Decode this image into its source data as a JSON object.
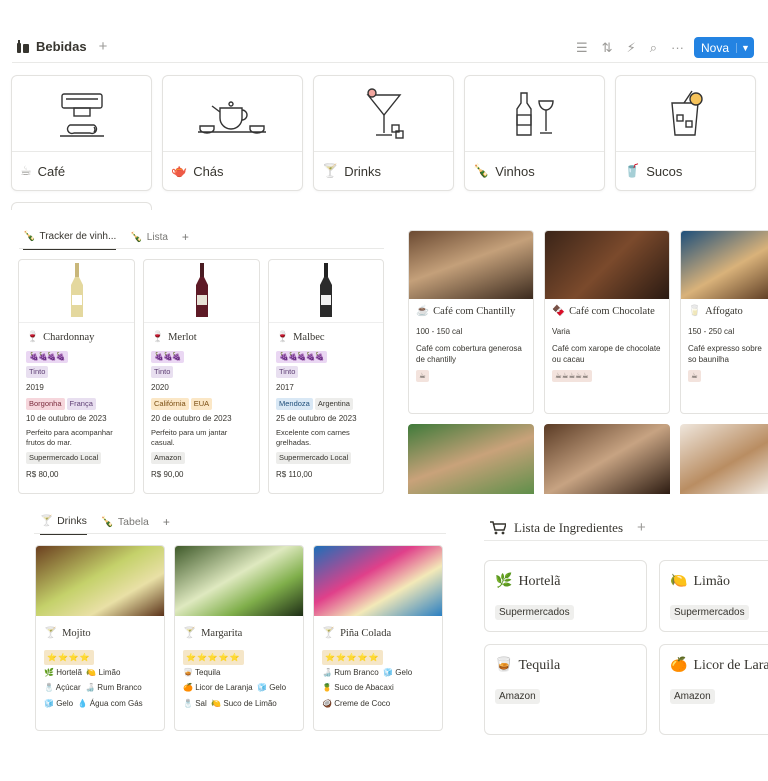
{
  "header": {
    "title": "Bebidas",
    "new_button": "Nova"
  },
  "categories": [
    {
      "label": "Café",
      "icon": "coffee-cup-icon"
    },
    {
      "label": "Chás",
      "icon": "teapot-icon"
    },
    {
      "label": "Drinks",
      "icon": "cocktail-glass-icon"
    },
    {
      "label": "Vinhos",
      "icon": "wine-bottle-icon"
    },
    {
      "label": "Sucos",
      "icon": "juice-cup-icon"
    }
  ],
  "wine_tabs": {
    "tab1": "Tracker de vinh...",
    "tab2": "Lista"
  },
  "wines": [
    {
      "name": "Chardonnay",
      "rating": "🍇🍇🍇🍇",
      "type": "Tinto",
      "year": "2019",
      "tags": [
        "Borgonha",
        "França"
      ],
      "date": "10 de outubro de 2023",
      "note": "Perfeito para acompanhar frutos do mar.",
      "store": "Supermercado Local",
      "price": "R$ 80,00"
    },
    {
      "name": "Merlot",
      "rating": "🍇🍇🍇",
      "type": "Tinto",
      "year": "2020",
      "tags": [
        "Califórnia",
        "EUA"
      ],
      "date": "20 de outubro de 2023",
      "note": "Perfeito para um jantar casual.",
      "store": "Amazon",
      "price": "R$ 90,00"
    },
    {
      "name": "Malbec",
      "rating": "🍇🍇🍇🍇🍇",
      "type": "Tinto",
      "year": "2017",
      "tags": [
        "Mendoza",
        "Argentina"
      ],
      "date": "25 de outubro de 2023",
      "note": "Excelente com carnes grelhadas.",
      "store": "Supermercado Local",
      "price": "R$ 110,00"
    }
  ],
  "coffees": [
    {
      "name": "Café com Chantilly",
      "cal": "100 - 150 cal",
      "desc": "Café com cobertura generosa de chantilly",
      "badge": "☕"
    },
    {
      "name": "Café com Chocolate",
      "cal": "Varia",
      "desc": "Café com xarope de chocolate ou cacau",
      "badge": "☕☕☕☕☕"
    },
    {
      "name": "Affogato",
      "cal": "150 - 250 cal",
      "desc": "Café expresso sobre so baunilha",
      "badge": "☕"
    }
  ],
  "drink_tabs": {
    "tab1": "Drinks",
    "tab2": "Tabela"
  },
  "drinks": [
    {
      "name": "Mojito",
      "stars": "⭐⭐⭐⭐",
      "ing": [
        [
          "Hortelã",
          "Limão"
        ],
        [
          "Açúcar",
          "Rum Branco"
        ],
        [
          "Gelo",
          "Água com Gás"
        ]
      ]
    },
    {
      "name": "Margarita",
      "stars": "⭐⭐⭐⭐⭐",
      "ing": [
        [
          "Tequila"
        ],
        [
          "Licor de Laranja",
          "Gelo"
        ],
        [
          "Sal",
          "Suco de Limão"
        ]
      ]
    },
    {
      "name": "Piña Colada",
      "stars": "⭐⭐⭐⭐⭐",
      "ing": [
        [
          "Rum Branco",
          "Gelo"
        ],
        [
          "Suco de Abacaxi"
        ],
        [
          "Creme de Coco"
        ]
      ]
    }
  ],
  "ingredients_title": "Lista de Ingredientes",
  "ingredients": [
    {
      "name": "Hortelã",
      "emoji": "🌿",
      "store": "Supermercados"
    },
    {
      "name": "Limão",
      "emoji": "🍋",
      "store": "Supermercados"
    },
    {
      "name": "Tequila",
      "emoji": "🥃",
      "store": "Amazon"
    },
    {
      "name": "Licor de Laranja",
      "emoji": "🍊",
      "store": "Amazon"
    }
  ],
  "colors": {
    "accent": "#2383e2",
    "wine_red": "#7a1f2b",
    "grape": "#ead7f3"
  }
}
